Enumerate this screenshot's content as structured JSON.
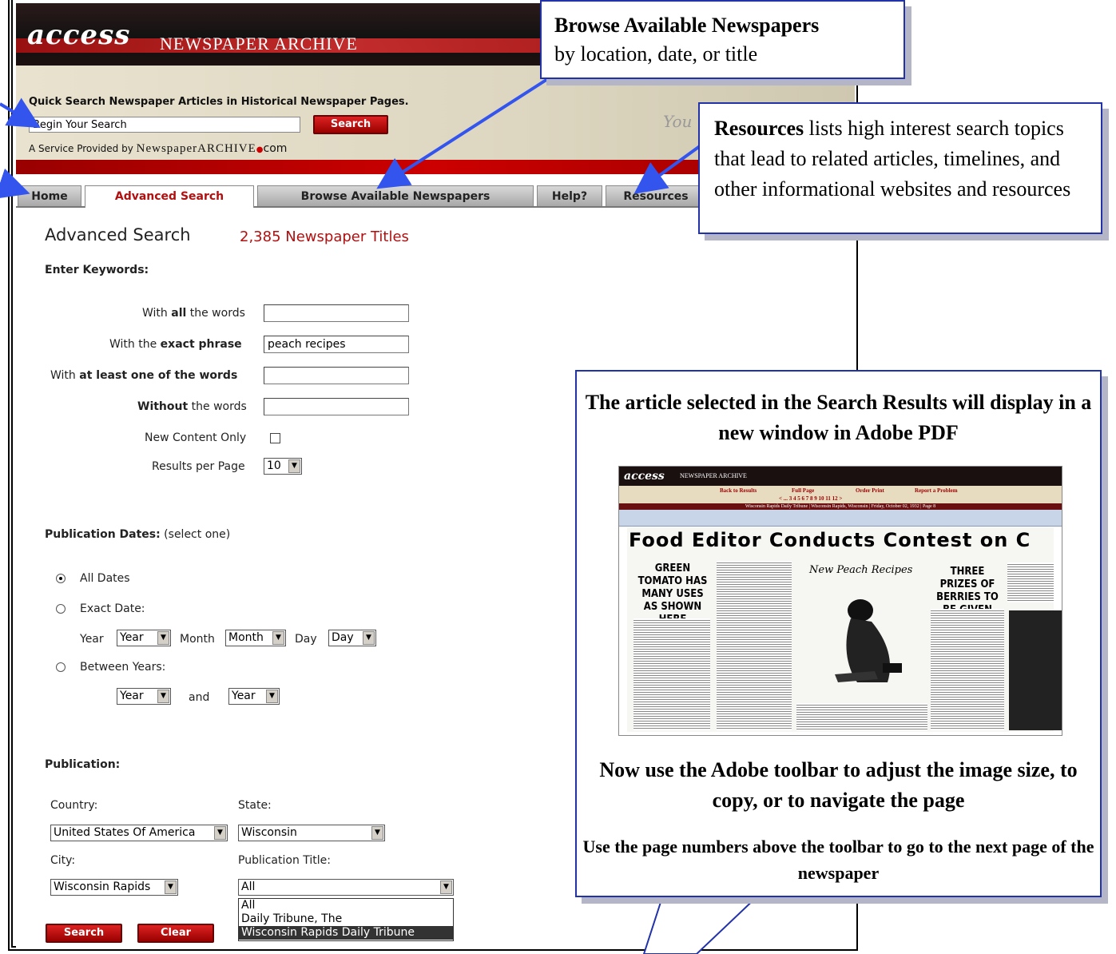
{
  "header": {
    "logo": "access",
    "logo_sub": "NEWSPAPER ARCHIVE"
  },
  "quick_search": {
    "title": "Quick Search Newspaper Articles in Historical Newspaper Pages.",
    "input_value": "Begin Your Search",
    "button": "Search",
    "service_prefix": "A Service Provided by",
    "service_brand": "NewspaperARCHIVE",
    "service_dot": "●",
    "service_suffix": "com",
    "bg_text": "You"
  },
  "tabs": [
    {
      "label": "Home",
      "active": false
    },
    {
      "label": "Advanced Search",
      "active": true
    },
    {
      "label": "Browse Available Newspapers",
      "active": false
    },
    {
      "label": "Help?",
      "active": false
    },
    {
      "label": "Resources",
      "active": false
    }
  ],
  "advanced": {
    "title": "Advanced Search",
    "count": "2,385 Newspaper Titles",
    "keywords_heading": "Enter Keywords:",
    "all_words_pre": "With ",
    "all_words_bold": "all",
    "all_words_post": " the words",
    "all_words_value": "",
    "exact_pre": "With the ",
    "exact_bold": "exact phrase",
    "exact_value": "peach recipes",
    "one_pre": "With ",
    "one_bold": "at least one of the words",
    "one_value": "",
    "without_bold": "Without",
    "without_post": " the words",
    "without_value": "",
    "new_content": "New Content Only",
    "results_per_page": "Results per Page",
    "results_value": "10"
  },
  "dates": {
    "heading": "Publication Dates:",
    "heading_note": " (select one)",
    "all_dates": "All Dates",
    "exact_date": "Exact Date:",
    "year_label": "Year",
    "year_value": "Year",
    "month_label": "Month",
    "month_value": "Month",
    "day_label": "Day",
    "day_value": "Day",
    "between": "Between Years:",
    "from_value": "Year",
    "and": "and",
    "to_value": "Year"
  },
  "publication": {
    "heading": "Publication:",
    "country_label": "Country:",
    "country_value": "United States Of America",
    "state_label": "State:",
    "state_value": "Wisconsin",
    "city_label": "City:",
    "city_value": "Wisconsin Rapids",
    "title_label": "Publication Title:",
    "title_value": "All",
    "title_options": [
      "All",
      "Daily Tribune, The",
      "Wisconsin Rapids Daily Tribune"
    ],
    "search_button": "Search",
    "clear_button": "Clear"
  },
  "callouts": {
    "browse_bold": "Browse Available Newspapers",
    "browse_text": "by location, date, or title",
    "resources_bold": "Resources",
    "resources_text": " lists high interest search topics that lead to related articles, timelines, and other informational websites and resources",
    "article_line1": "The article selected in the Search Results will display in a new window in Adobe PDF",
    "adobe_line": "Now use the Adobe toolbar to adjust the image size, to copy, or to navigate the page",
    "pages_line": "Use the page numbers above the toolbar to go to the next page of the newspaper"
  },
  "article_preview": {
    "logo": "access",
    "logo_sub": "NEWSPAPER ARCHIVE",
    "nav": [
      "Back to Results",
      "Full Page",
      "Order Print",
      "Report a Problem"
    ],
    "pages": "< ... 3 4 5 6 7 8 9 10 11 12 >",
    "bar": "Wisconsin Rapids Daily Tribune | Wisconsin Rapids, Wisconsin | Friday, October 02, 1932 | Page 8",
    "headline": "Food  Editor  Conducts  Contest  on  C",
    "sub1": "GREEN TOMATO HAS MANY USES AS SHOWN HERE",
    "sub2": "New Peach Recipes",
    "sub3": "THREE PRIZES OF BERRIES TO BE GIVEN OUT"
  },
  "colors": {
    "accent_red": "#b01010",
    "callout_border": "#2233aa",
    "arrow": "#3355ee"
  }
}
